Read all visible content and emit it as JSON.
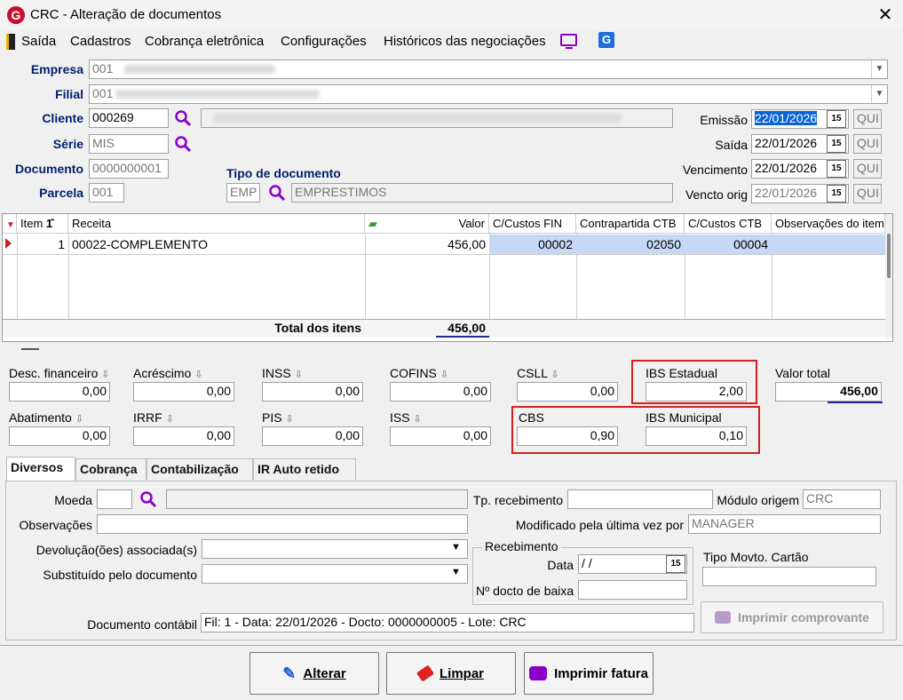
{
  "window": {
    "title": "CRC - Alteração de documentos"
  },
  "menu": {
    "items": [
      "Saída",
      "Cadastros",
      "Cobrança eletrônica",
      "Configurações",
      "Históricos das negociações"
    ]
  },
  "header": {
    "empresa_label": "Empresa",
    "empresa_value": "001",
    "filial_label": "Filial",
    "filial_value": "001",
    "cliente_label": "Cliente",
    "cliente_value": "000269",
    "serie_label": "Série",
    "serie_value": "MIS",
    "documento_label": "Documento",
    "documento_value": "0000000001",
    "parcela_label": "Parcela",
    "parcela_value": "001",
    "tipo_doc_label": "Tipo de documento",
    "tipo_doc_code": "EMP",
    "tipo_doc_desc": "EMPRESTIMOS",
    "emissao_label": "Emissão",
    "emissao_value": "22/01/2026",
    "emissao_day": "QUI",
    "saida_label": "Saída",
    "saida_value": "22/01/2026",
    "saida_day": "QUI",
    "vencimento_label": "Vencimento",
    "vencimento_value": "22/01/2026",
    "vencimento_day": "QUI",
    "vencto_orig_label": "Vencto orig",
    "vencto_orig_value": "22/01/2026",
    "vencto_orig_day": "QUI"
  },
  "grid": {
    "columns": [
      "Item",
      "Receita",
      "Valor",
      "C/Custos FIN",
      "Contrapartida CTB",
      "C/Custos CTB",
      "Observações do item"
    ],
    "rows": [
      {
        "item": "1",
        "receita": "00022-COMPLEMENTO",
        "valor": "456,00",
        "ccfin": "00002",
        "contrapartida": "02050",
        "ccctb": "00004",
        "obs": ""
      }
    ],
    "total_label": "Total dos itens",
    "total_value": "456,00"
  },
  "taxes": {
    "desc_fin_label": "Desc. financeiro",
    "desc_fin": "0,00",
    "acrescimo_label": "Acréscimo",
    "acrescimo": "0,00",
    "inss_label": "INSS",
    "inss": "0,00",
    "cofins_label": "COFINS",
    "cofins": "0,00",
    "csll_label": "CSLL",
    "csll": "0,00",
    "ibs_estadual_label": "IBS Estadual",
    "ibs_estadual": "2,00",
    "valor_total_label": "Valor total",
    "valor_total": "456,00",
    "abatimento_label": "Abatimento",
    "abatimento": "0,00",
    "irrf_label": "IRRF",
    "irrf": "0,00",
    "pis_label": "PIS",
    "pis": "0,00",
    "iss_label": "ISS",
    "iss": "0,00",
    "cbs_label": "CBS",
    "cbs": "0,90",
    "ibs_municipal_label": "IBS Municipal",
    "ibs_municipal": "0,10"
  },
  "tabs": [
    "Diversos",
    "Cobrança",
    "Contabilização",
    "IR Auto retido"
  ],
  "diversos": {
    "moeda_label": "Moeda",
    "moeda_value": "",
    "obs_label": "Observações",
    "obs_value": "",
    "devolucao_label": "Devolução(ões) associada(s)",
    "devolucao_value": "",
    "substituido_label": "Substituído pelo documento",
    "substituido_value": "",
    "tp_receb_label": "Tp. recebimento",
    "tp_receb_value": "",
    "modulo_label": "Módulo origem",
    "modulo_value": "CRC",
    "modificado_label": "Modificado pela última vez por",
    "modificado_value": "MANAGER",
    "recebimento_group": "Recebimento",
    "data_label": "Data",
    "data_value": " / /",
    "ndocto_label": "Nº docto de baixa",
    "ndocto_value": "",
    "tipo_movto_label": "Tipo Movto. Cartão",
    "tipo_movto_value": "",
    "imprimir_comp": "Imprimir comprovante",
    "doc_contabil_label": "Documento contábil",
    "doc_contabil_value": "Fil: 1 - Data: 22/01/2026 - Docto: 0000000005 - Lote: CRC"
  },
  "buttons": {
    "alterar": "Alterar",
    "limpar": "Limpar",
    "imprimir_fatura": "Imprimir fatura"
  },
  "colors": {
    "label_blue": "#001f6b",
    "highlight_red": "#d0201f",
    "underline_blue": "#1e2a9a",
    "selection": "#c5d8f5",
    "brand_red": "#c8102e"
  }
}
